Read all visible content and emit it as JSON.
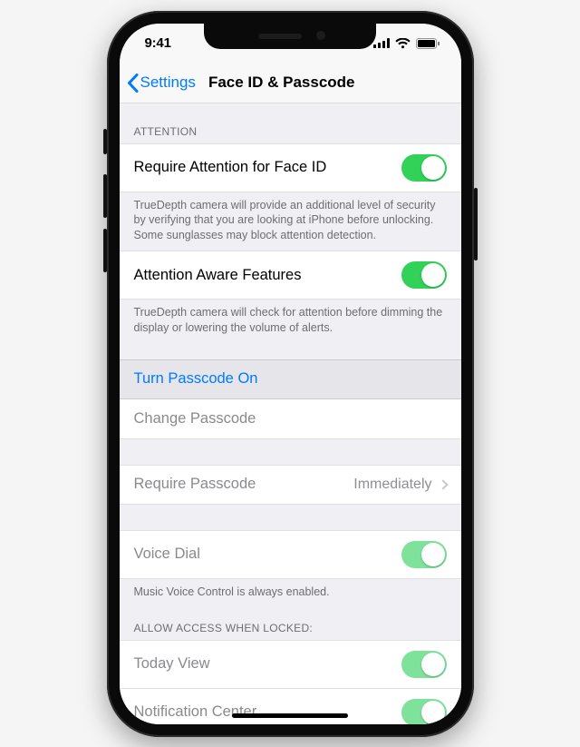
{
  "status": {
    "time": "9:41"
  },
  "nav": {
    "back": "Settings",
    "title": "Face ID & Passcode"
  },
  "attention": {
    "header": "Attention",
    "require_label": "Require Attention for Face ID",
    "require_on": true,
    "require_note": "TrueDepth camera will provide an additional level of security by verifying that you are looking at iPhone before unlocking. Some sunglasses may block attention detection.",
    "aware_label": "Attention Aware Features",
    "aware_on": true,
    "aware_note": "TrueDepth camera will check for attention before dimming the display or lowering the volume of alerts."
  },
  "passcode": {
    "turn_on": "Turn Passcode On",
    "change": "Change Passcode",
    "require_label": "Require Passcode",
    "require_value": "Immediately"
  },
  "voice": {
    "label": "Voice Dial",
    "on": true,
    "note": "Music Voice Control is always enabled."
  },
  "locked": {
    "header": "Allow Access When Locked:",
    "today": "Today View",
    "notif": "Notification Center"
  }
}
